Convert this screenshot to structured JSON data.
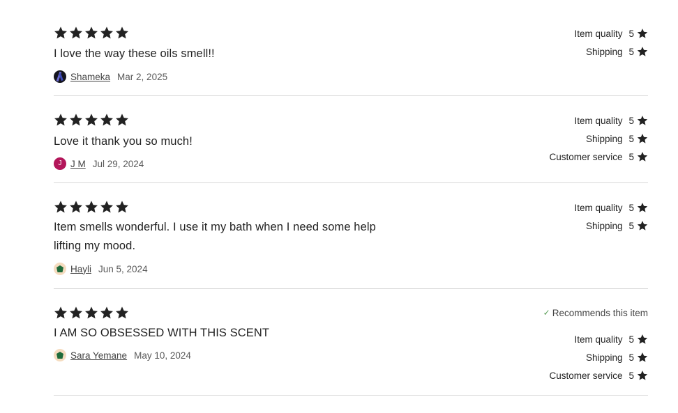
{
  "reviews": [
    {
      "stars": 5,
      "text": "I love the way these oils smell!!",
      "reviewer": "Shameka",
      "date": "Mar 2, 2025",
      "avatar": {
        "type": "image"
      },
      "ratings": [
        {
          "label": "Item quality",
          "value": "5"
        },
        {
          "label": "Shipping",
          "value": "5"
        }
      ]
    },
    {
      "stars": 5,
      "text": "Love it thank you so much!",
      "reviewer": "J M",
      "date": "Jul 29, 2024",
      "avatar": {
        "type": "letter",
        "letter": "J"
      },
      "ratings": [
        {
          "label": "Item quality",
          "value": "5"
        },
        {
          "label": "Shipping",
          "value": "5"
        },
        {
          "label": "Customer service",
          "value": "5"
        }
      ]
    },
    {
      "stars": 5,
      "text": "Item smells wonderful. I use it my bath when I need some help lifting my mood.",
      "text_line1": "Item smells wonderful. I use it my bath when I need some help",
      "text_line2": "lifting my mood.",
      "reviewer": "Hayli",
      "date": "Jun 5, 2024",
      "avatar": {
        "type": "default"
      },
      "ratings": [
        {
          "label": "Item quality",
          "value": "5"
        },
        {
          "label": "Shipping",
          "value": "5"
        }
      ]
    },
    {
      "stars": 5,
      "text": "I AM SO OBSESSED WITH THIS SCENT",
      "reviewer": "Sara Yemane",
      "date": "May 10, 2024",
      "avatar": {
        "type": "default"
      },
      "recommends": "Recommends this item",
      "ratings": [
        {
          "label": "Item quality",
          "value": "5"
        },
        {
          "label": "Shipping",
          "value": "5"
        },
        {
          "label": "Customer service",
          "value": "5"
        }
      ]
    }
  ],
  "colors": {
    "text": "#222222",
    "divider": "#d8d8d8",
    "check": "#5a9e58",
    "avatar_letter_bg": "#b3165a"
  }
}
